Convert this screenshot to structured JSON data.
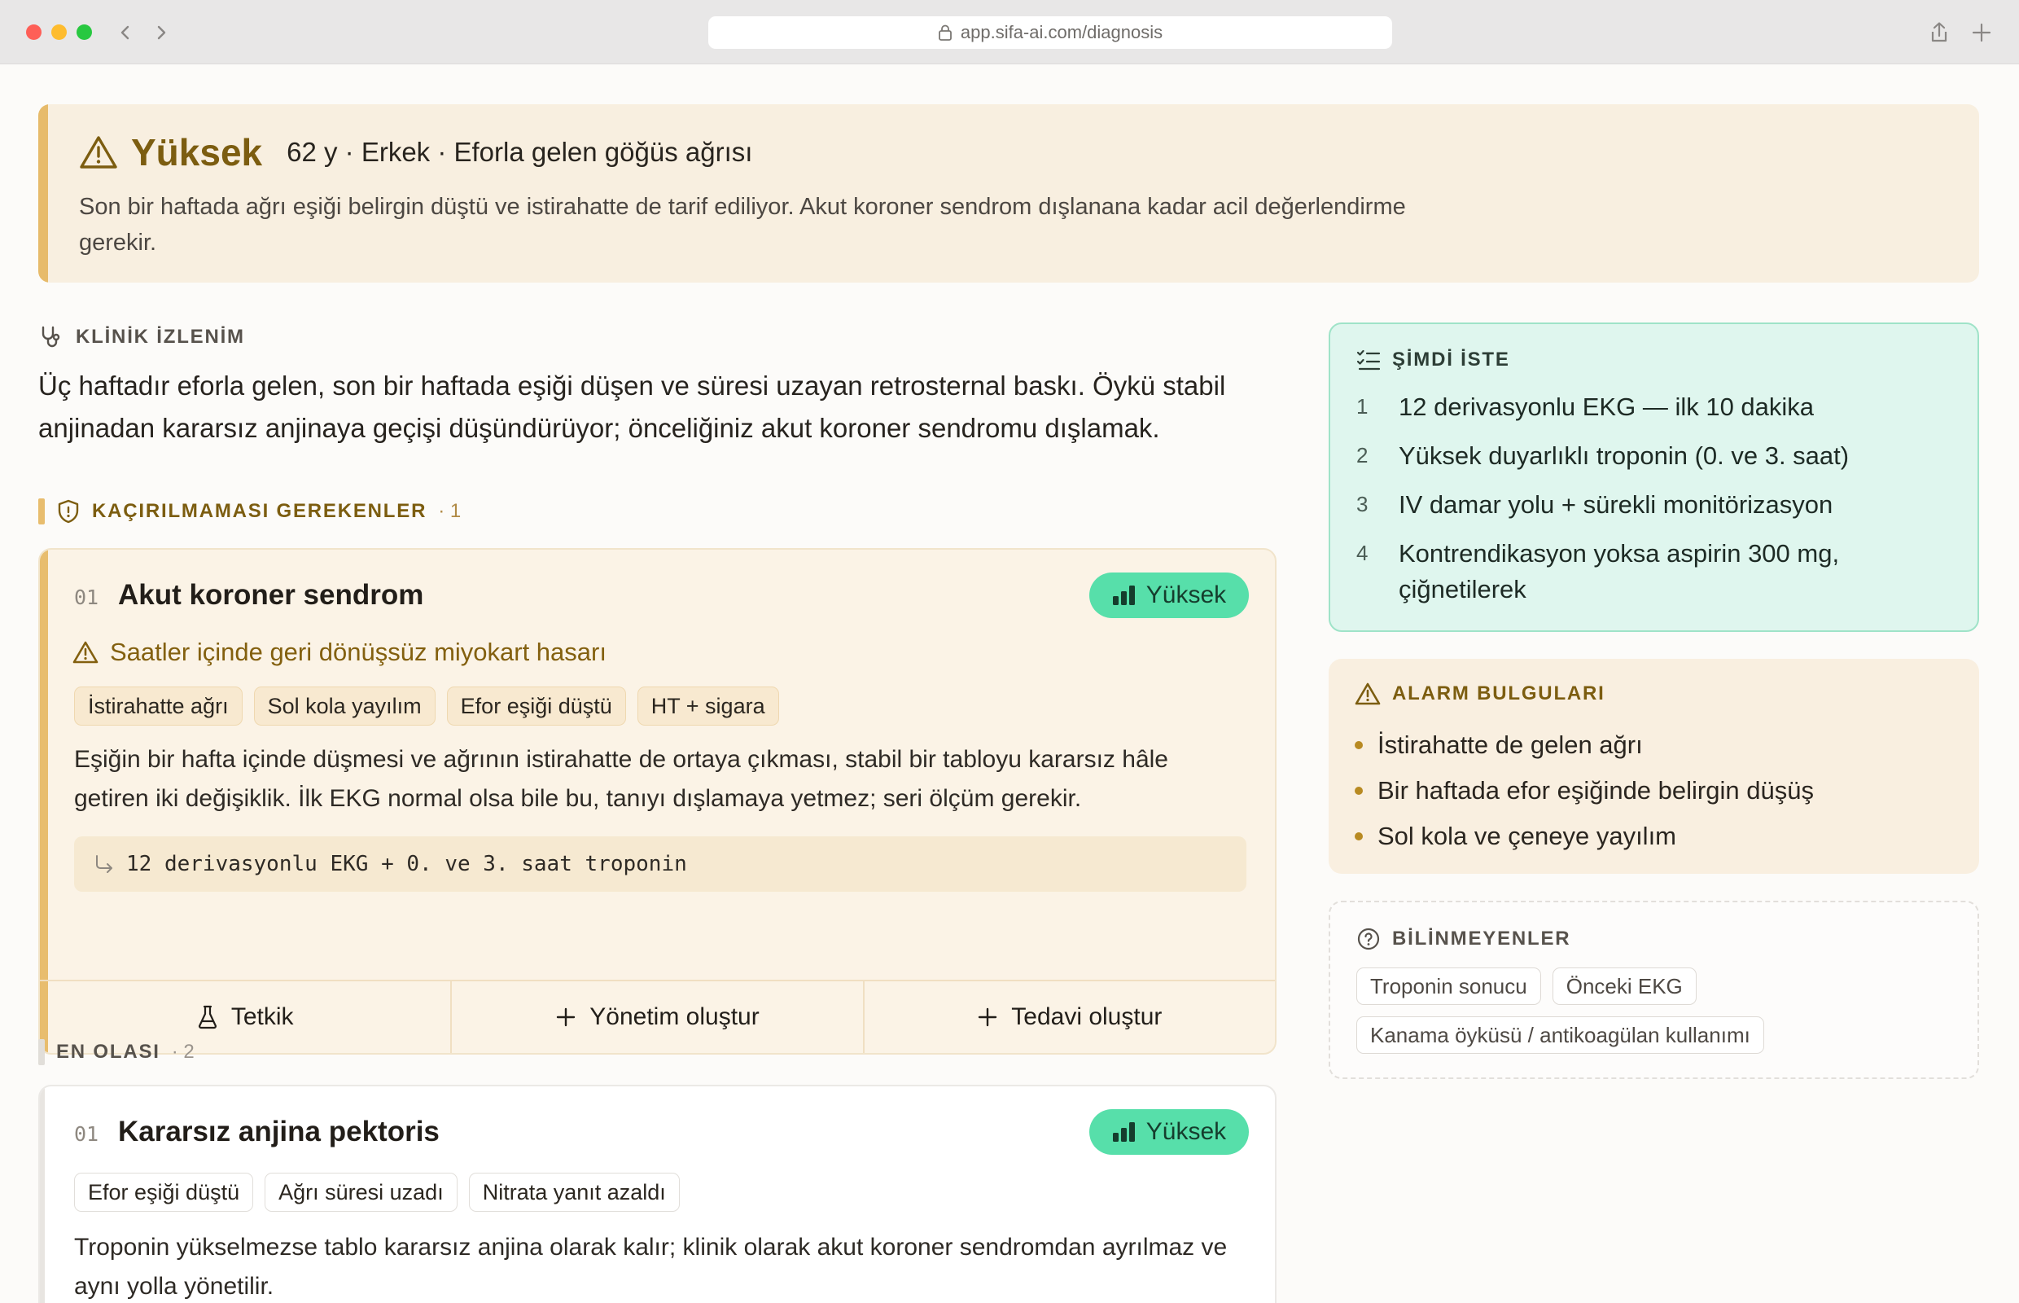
{
  "browser": {
    "url": "app.sifa-ai.com/diagnosis"
  },
  "alert": {
    "level": "Yüksek",
    "patient": "62 y · Erkek · Eforla gelen göğüs ağrısı",
    "message": "Son bir haftada ağrı eşiği belirgin düştü ve istirahatte de tarif ediliyor. Akut koroner sendrom dışlanana kadar acil değerlendirme gerekir.",
    "accent_color": "#e7bb6b"
  },
  "impression": {
    "heading": "KLİNİK İZLENİM",
    "text": "Üç haftadır eforla gelen, son bir haftada eşiği düşen ve süresi uzayan retrosternal baskı. Öykü stabil anjinadan kararsız anjinaya geçişi düşündürüyor; önceliğiniz akut koroner sendromu dışlamak."
  },
  "must_not_miss": {
    "heading": "KAÇIRILMAMASI GEREKENLER",
    "count": "· 1",
    "card": {
      "num": "01",
      "title": "Akut koroner sendrom",
      "badge": "Yüksek",
      "warning": "Saatler içinde geri dönüşsüz miyokart hasarı",
      "tags": [
        "İstirahatte ağrı",
        "Sol kola yayılım",
        "Efor eşiği düştü",
        "HT + sigara"
      ],
      "description": "Eşiğin bir hafta içinde düşmesi ve ağrının istirahatte de ortaya çıkması, stabil bir tabloyu kararsız hâle getiren iki değişiklik. İlk EKG normal olsa bile bu, tanıyı dışlamaya yetmez; seri ölçüm gerekir.",
      "test": "12 derivasyonlu EKG + 0. ve 3. saat troponin",
      "actions": [
        "Tetkik",
        "Yönetim oluştur",
        "Tedavi oluştur"
      ]
    }
  },
  "most_likely": {
    "heading": "EN OLASI",
    "count": "· 2",
    "card": {
      "num": "01",
      "title": "Kararsız anjina pektoris",
      "badge": "Yüksek",
      "tags": [
        "Efor eşiği düştü",
        "Ağrı süresi uzadı",
        "Nitrata yanıt azaldı"
      ],
      "description": "Troponin yükselmezse tablo kararsız anjina olarak kalır; klinik olarak akut koroner sendromdan ayrılmaz ve aynı yolla yönetilir."
    }
  },
  "order_now": {
    "heading": "ŞİMDİ İSTE",
    "items": [
      {
        "n": "1",
        "text": "12 derivasyonlu EKG — ilk 10 dakika"
      },
      {
        "n": "2",
        "text": "Yüksek duyarlıklı troponin (0. ve 3. saat)"
      },
      {
        "n": "3",
        "text": "IV damar yolu + sürekli monitörizasyon"
      },
      {
        "n": "4",
        "text": "Kontrendikasyon yoksa aspirin 300 mg, çiğnetilerek"
      }
    ]
  },
  "alarm": {
    "heading": "ALARM BULGULARI",
    "items": [
      "İstirahatte de gelen ağrı",
      "Bir haftada efor eşiğinde belirgin düşüş",
      "Sol kola ve çeneye yayılım"
    ]
  },
  "unknowns": {
    "heading": "BİLİNMEYENLER",
    "items": [
      "Troponin sonucu",
      "Önceki EKG",
      "Kanama öyküsü / antikoagülan kullanımı"
    ]
  },
  "colors": {
    "warning_text": "#7c5d10",
    "badge_green": "#57dfaa",
    "panel_green": "#dff6ee",
    "panel_cream": "#f9efe0"
  }
}
